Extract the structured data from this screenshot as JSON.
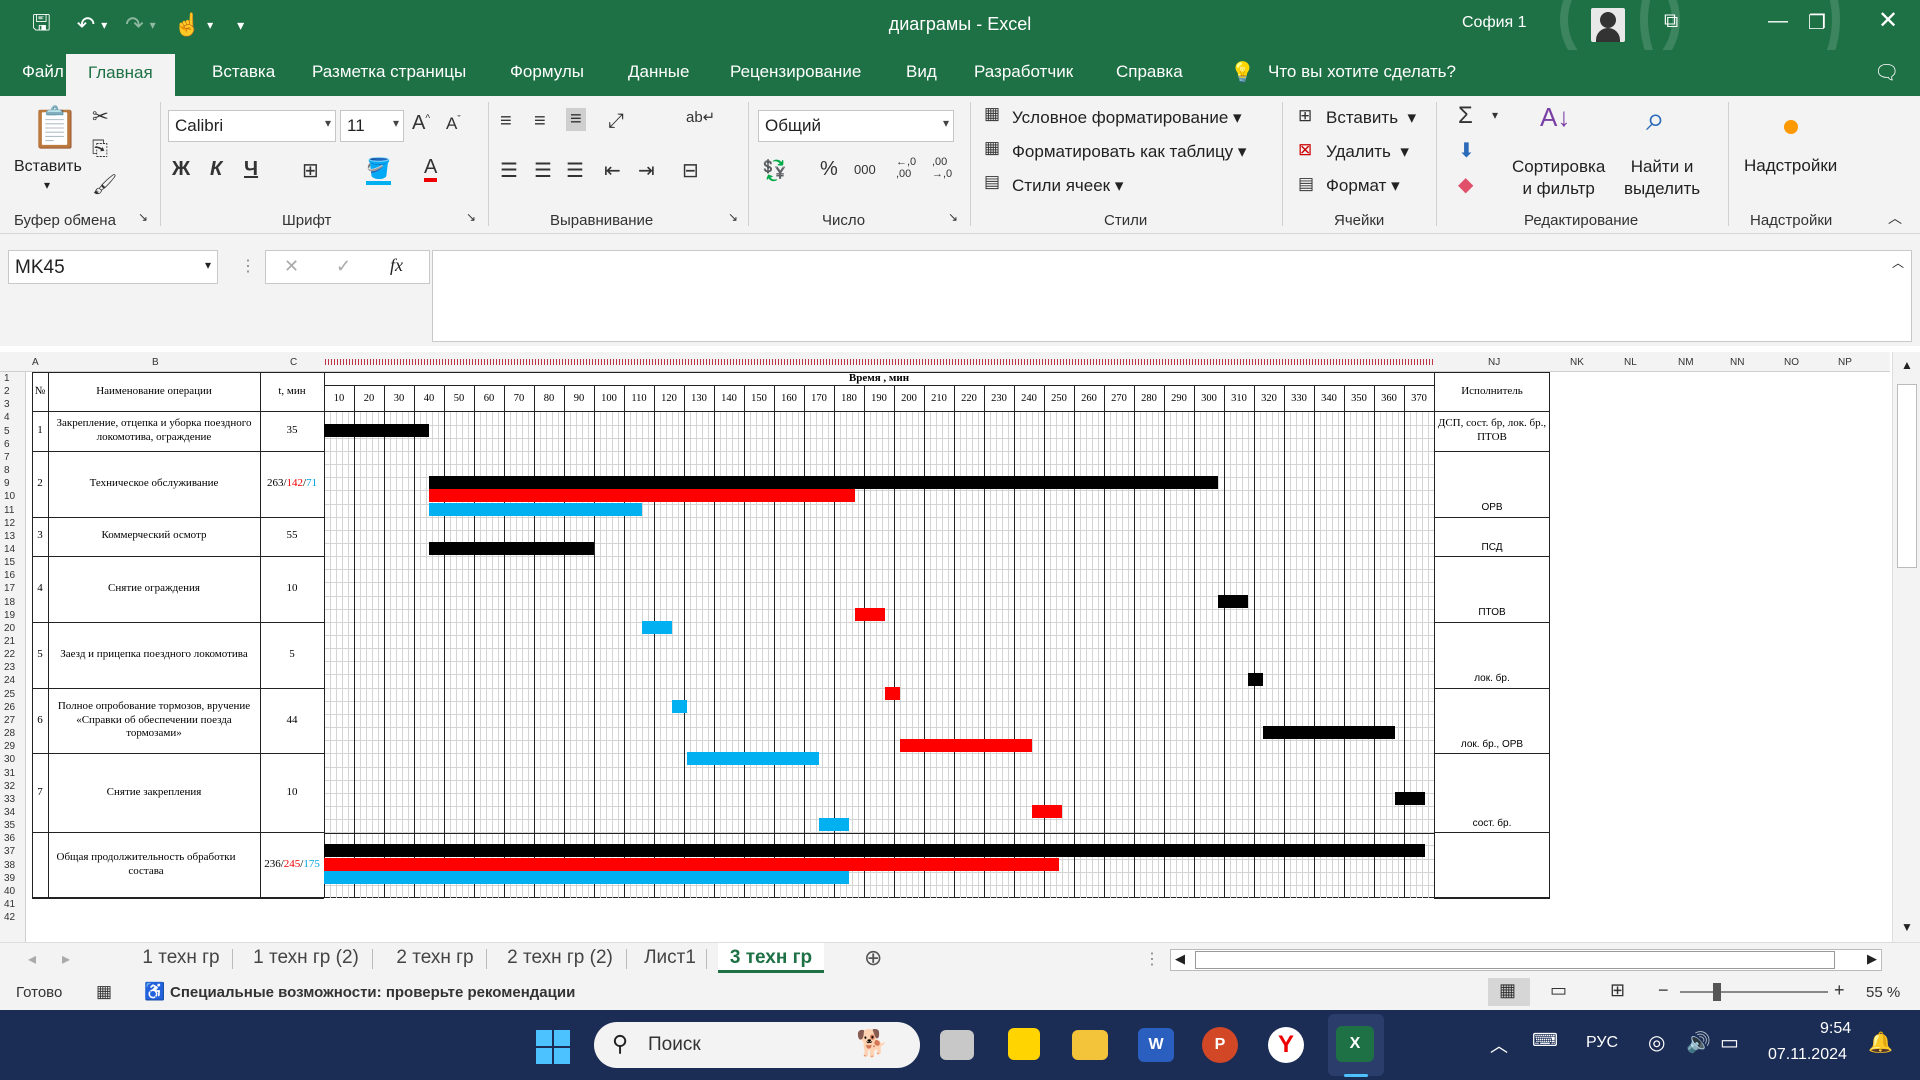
{
  "window": {
    "doc_title": "диаграмы  -  Excel",
    "user": "София 1"
  },
  "menu": [
    "Файл",
    "Главная",
    "Вставка",
    "Разметка страницы",
    "Формулы",
    "Данные",
    "Рецензирование",
    "Вид",
    "Разработчик",
    "Справка"
  ],
  "menu_active": "Главная",
  "tell_me": "Что вы хотите сделать?",
  "ribbon": {
    "paste": "Вставить",
    "font_name": "Calibri",
    "font_size": "11",
    "bold": "Ж",
    "italic": "К",
    "underline": "Ч",
    "number_format": "Общий",
    "percent": "%",
    "thousands": "000",
    "dec_inc": "←,0\n,00",
    "dec_dec": ",00\n→,0",
    "cond_format": "Условное форматирование",
    "format_table": "Форматировать как таблицу",
    "cell_styles": "Стили ячеек",
    "insert": "Вставить",
    "delete": "Удалить",
    "format": "Формат",
    "sort": "Сортировка\nи фильтр",
    "find": "Найти и\nвыделить",
    "addins": "Надстройки",
    "groups": [
      "Буфер обмена",
      "Шрифт",
      "Выравнивание",
      "Число",
      "Стили",
      "Ячейки",
      "Редактирование",
      "Надстройки"
    ]
  },
  "formula_bar": {
    "name_box": "MK45",
    "fx": "fx",
    "value": ""
  },
  "columns": {
    "left": [
      "A",
      "B",
      "C"
    ],
    "right": [
      "NJ",
      "NK",
      "NL",
      "NM",
      "NN",
      "NO",
      "NP"
    ]
  },
  "rows": [
    "1",
    "2",
    "3",
    "4",
    "5",
    "6",
    "7",
    "8",
    "9",
    "10",
    "11",
    "12",
    "13",
    "14",
    "15",
    "16",
    "17",
    "18",
    "19",
    "20",
    "21",
    "22",
    "23",
    "24",
    "25",
    "26",
    "27",
    "28",
    "29",
    "30",
    "31",
    "32",
    "33",
    "34",
    "35",
    "36",
    "37",
    "38",
    "39",
    "40",
    "41",
    "42"
  ],
  "table": {
    "h_num": "№",
    "h_name": "Наименование операции",
    "h_time": "t, мин",
    "h_axis": "Время , мин",
    "h_exec": "Исполнитель",
    "ticks": [
      "10",
      "20",
      "30",
      "40",
      "50",
      "60",
      "70",
      "80",
      "90",
      "100",
      "110",
      "120",
      "130",
      "140",
      "150",
      "160",
      "170",
      "180",
      "190",
      "200",
      "210",
      "220",
      "230",
      "240",
      "250",
      "260",
      "270",
      "280",
      "290",
      "300",
      "310",
      "320",
      "330",
      "340",
      "350",
      "360",
      "370"
    ],
    "ops": [
      {
        "n": "1",
        "name": "Закрепление, отцепка и уборка поездного локомотива, ограждение",
        "t": "35",
        "exec": "ДСП, сост. бр, лок. бр., ПТОВ"
      },
      {
        "n": "2",
        "name": "Техническое обслуживание",
        "t1": "263",
        "t2": "142",
        "t3": "71",
        "exec": "ОРВ"
      },
      {
        "n": "3",
        "name": "Коммерческий осмотр",
        "t": "55",
        "exec": "ПСД"
      },
      {
        "n": "4",
        "name": "Снятие ограждения",
        "t": "10",
        "exec": "ПТОВ"
      },
      {
        "n": "5",
        "name": "Заезд и прицепка поездного локомотива",
        "t": "5",
        "exec": "лок. бр."
      },
      {
        "n": "6",
        "name": "Полное опробование тормозов, вручение «Справки об обеспечении поезда тормозами»",
        "t": "44",
        "exec": "лок. бр., ОРВ"
      },
      {
        "n": "7",
        "name": "Снятие закрепления",
        "t": "10",
        "exec": "сост. бр."
      }
    ],
    "total": {
      "name": "Общая продолжительность обработки состава",
      "t1": "236",
      "t2": "245",
      "t3": "175"
    }
  },
  "gantt": {
    "colors": {
      "black": "#000000",
      "red": "#ff0000",
      "blue": "#00b0f0"
    },
    "unit": "мин",
    "bars": [
      {
        "series": "black",
        "start": 0,
        "end": 35
      },
      {
        "series": "black",
        "start": 35,
        "end": 298
      },
      {
        "series": "red",
        "start": 35,
        "end": 177
      },
      {
        "series": "blue",
        "start": 35,
        "end": 106
      },
      {
        "series": "black",
        "start": 35,
        "end": 90
      },
      {
        "series": "black",
        "start": 298,
        "end": 308
      },
      {
        "series": "red",
        "start": 177,
        "end": 187
      },
      {
        "series": "blue",
        "start": 106,
        "end": 116
      },
      {
        "series": "black",
        "start": 308,
        "end": 313
      },
      {
        "series": "red",
        "start": 187,
        "end": 192
      },
      {
        "series": "blue",
        "start": 116,
        "end": 121
      },
      {
        "series": "black",
        "start": 313,
        "end": 357
      },
      {
        "series": "red",
        "start": 192,
        "end": 236
      },
      {
        "series": "blue",
        "start": 121,
        "end": 165
      },
      {
        "series": "black",
        "start": 357,
        "end": 367
      },
      {
        "series": "red",
        "start": 236,
        "end": 246
      },
      {
        "series": "blue",
        "start": 165,
        "end": 175
      },
      {
        "series": "black",
        "start": 0,
        "end": 367
      },
      {
        "series": "red",
        "start": 0,
        "end": 245
      },
      {
        "series": "blue",
        "start": 0,
        "end": 175
      }
    ]
  },
  "sheet_tabs": [
    "1 техн гр",
    "1 техн гр (2)",
    "2 техн гр",
    "2 техн гр (2)",
    "Лист1",
    "3 техн гр"
  ],
  "active_sheet": "3 техн гр",
  "status": {
    "ready": "Готово",
    "accessibility": "Специальные возможности: проверьте рекомендации",
    "zoom": "55 %"
  },
  "taskbar": {
    "search": "Поиск",
    "lang": "РУС",
    "time": "9:54",
    "date": "07.11.2024"
  }
}
